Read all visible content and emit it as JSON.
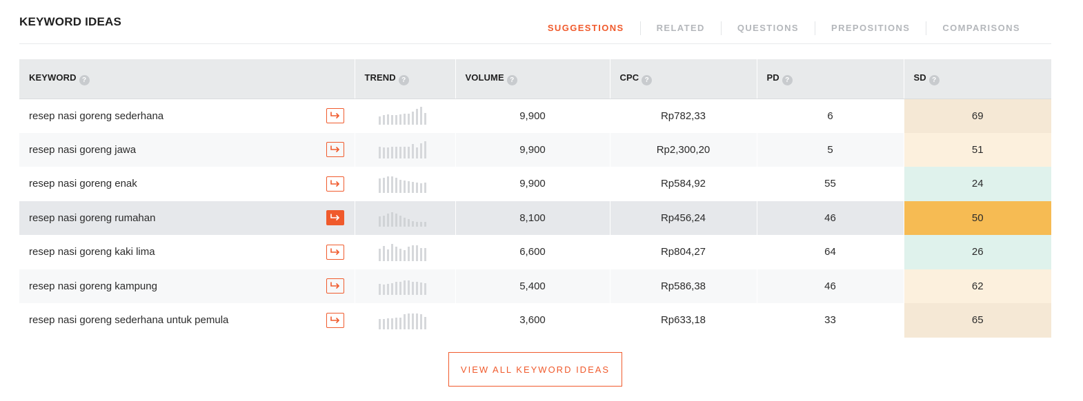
{
  "title": "KEYWORD IDEAS",
  "tabs": [
    {
      "label": "SUGGESTIONS",
      "active": true
    },
    {
      "label": "RELATED",
      "active": false
    },
    {
      "label": "QUESTIONS",
      "active": false
    },
    {
      "label": "PREPOSITIONS",
      "active": false
    },
    {
      "label": "COMPARISONS",
      "active": false
    }
  ],
  "columns": {
    "keyword": "KEYWORD",
    "trend": "TREND",
    "volume": "VOLUME",
    "cpc": "CPC",
    "pd": "PD",
    "sd": "SD",
    "help_glyph": "?"
  },
  "accent_color": "#f05a2c",
  "sd_colors": {
    "low": "#dff2ec",
    "medium": "#fcf0dd",
    "high": "#f5e8d5",
    "selected": "#f6bb53"
  },
  "rows": [
    {
      "keyword": "resep nasi goreng sederhana",
      "trend": [
        0.35,
        0.45,
        0.5,
        0.45,
        0.45,
        0.5,
        0.55,
        0.55,
        0.7,
        0.85,
        1.0,
        0.6
      ],
      "volume": "9,900",
      "cpc": "Rp782,33",
      "pd": "6",
      "sd": "69",
      "sd_level": "high"
    },
    {
      "keyword": "resep nasi goreng jawa",
      "trend": [
        0.6,
        0.55,
        0.55,
        0.6,
        0.6,
        0.6,
        0.6,
        0.6,
        0.75,
        0.55,
        0.8,
        0.95
      ],
      "volume": "9,900",
      "cpc": "Rp2,300,20",
      "pd": "5",
      "sd": "51",
      "sd_level": "medium"
    },
    {
      "keyword": "resep nasi goreng enak",
      "trend": [
        0.75,
        0.8,
        0.9,
        0.9,
        0.8,
        0.7,
        0.65,
        0.6,
        0.55,
        0.5,
        0.45,
        0.5
      ],
      "volume": "9,900",
      "cpc": "Rp584,92",
      "pd": "55",
      "sd": "24",
      "sd_level": "low"
    },
    {
      "keyword": "resep nasi goreng rumahan",
      "trend": [
        0.5,
        0.55,
        0.7,
        0.75,
        0.7,
        0.55,
        0.4,
        0.3,
        0.2,
        0.15,
        0.15,
        0.15
      ],
      "volume": "8,100",
      "cpc": "Rp456,24",
      "pd": "46",
      "sd": "50",
      "sd_level": "selected",
      "highlighted": true
    },
    {
      "keyword": "resep nasi goreng kaki lima",
      "trend": [
        0.65,
        0.8,
        0.6,
        0.95,
        0.75,
        0.65,
        0.55,
        0.75,
        0.85,
        0.85,
        0.7,
        0.7
      ],
      "volume": "6,600",
      "cpc": "Rp804,27",
      "pd": "64",
      "sd": "26",
      "sd_level": "low"
    },
    {
      "keyword": "resep nasi goreng kampung",
      "trend": [
        0.55,
        0.5,
        0.55,
        0.6,
        0.7,
        0.7,
        0.75,
        0.75,
        0.7,
        0.7,
        0.65,
        0.6
      ],
      "volume": "5,400",
      "cpc": "Rp586,38",
      "pd": "46",
      "sd": "62",
      "sd_level": "medium"
    },
    {
      "keyword": "resep nasi goreng sederhana untuk pemula",
      "trend": [
        0.5,
        0.5,
        0.55,
        0.55,
        0.6,
        0.6,
        0.8,
        0.85,
        0.85,
        0.85,
        0.8,
        0.65
      ],
      "volume": "3,600",
      "cpc": "Rp633,18",
      "pd": "33",
      "sd": "65",
      "sd_level": "high"
    }
  ],
  "view_all_label": "VIEW ALL KEYWORD IDEAS"
}
